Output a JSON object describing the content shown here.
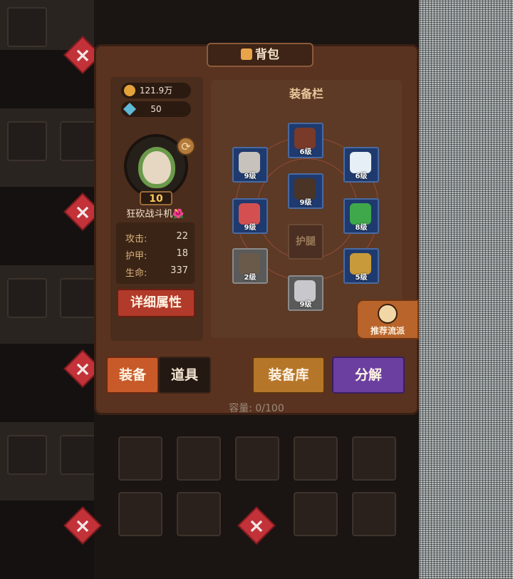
{
  "window": {
    "title": "背包"
  },
  "currency": {
    "gold": "121.9万",
    "gems": "50"
  },
  "character": {
    "level": "10",
    "name": "狂砍战斗机🌺"
  },
  "stats": [
    {
      "label": "攻击:",
      "value": "22"
    },
    {
      "label": "护甲:",
      "value": "18"
    },
    {
      "label": "生命:",
      "value": "337"
    }
  ],
  "buttons": {
    "detail": "详细属性",
    "recommend": "推荐流派",
    "store": "装备库",
    "disassemble": "分解"
  },
  "equipment": {
    "title": "装备栏",
    "slots": [
      {
        "id": "hat",
        "level": "6级",
        "color": "#7a3a2a"
      },
      {
        "id": "helmet",
        "level": "9级",
        "color": "#c8c2bc"
      },
      {
        "id": "feather",
        "level": "6级",
        "color": "#e6eef6"
      },
      {
        "id": "armor",
        "level": "9级",
        "color": "#4a3426"
      },
      {
        "id": "gauntlet",
        "level": "9级",
        "color": "#d45050"
      },
      {
        "id": "ring",
        "level": "8级",
        "color": "#3ea84a"
      },
      {
        "id": "legs",
        "empty_label": "护腿"
      },
      {
        "id": "crossbow",
        "level": "2级",
        "color": "#6a5a4a"
      },
      {
        "id": "scrolls",
        "level": "5级",
        "color": "#c89a3a"
      },
      {
        "id": "boots",
        "level": "9级",
        "color": "#c8c8cc"
      }
    ]
  },
  "tabs": [
    {
      "label": "装备",
      "active": true
    },
    {
      "label": "道具",
      "active": false
    }
  ],
  "capacity": "容量: 0/100"
}
